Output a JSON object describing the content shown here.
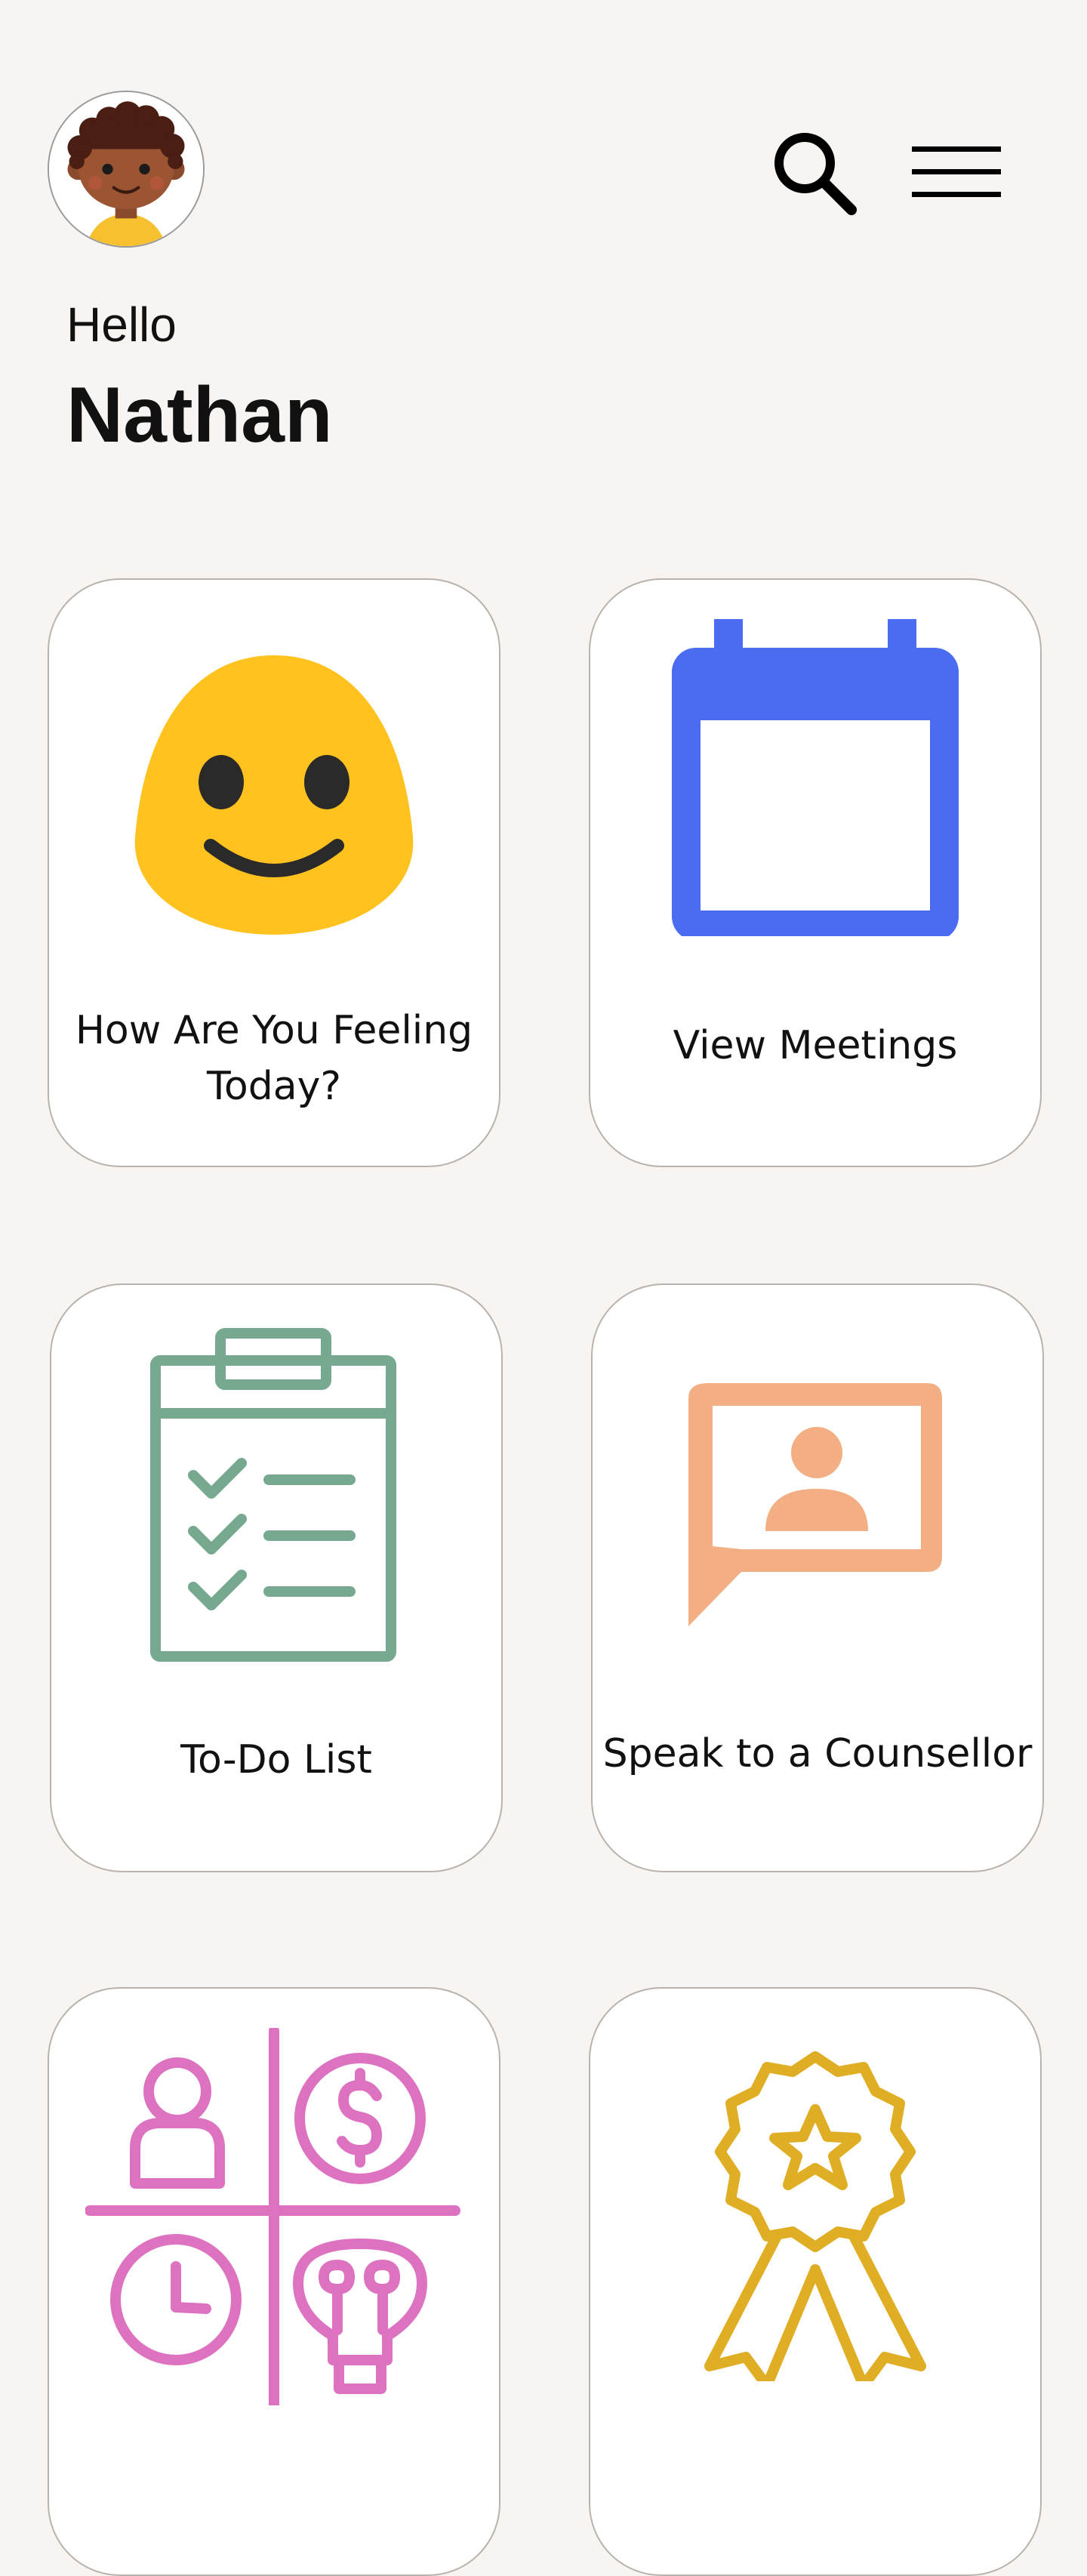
{
  "header": {
    "greeting": "Hello",
    "user_name": "Nathan"
  },
  "icons": {
    "avatar": "child-avatar",
    "search": "search-icon",
    "menu": "hamburger-menu-icon"
  },
  "cards": [
    {
      "label": "How Are You Feeling Today?",
      "icon": "smiley-face-icon",
      "color": "#FFC21F"
    },
    {
      "label": "View Meetings",
      "icon": "calendar-icon",
      "color": "#4A6CF0"
    },
    {
      "label": "To-Do List",
      "icon": "checklist-clipboard-icon",
      "color": "#76A98F"
    },
    {
      "label": "Speak to a Counsellor",
      "icon": "chat-person-icon",
      "color": "#F3AF83"
    },
    {
      "label": "",
      "icon": "quadrants-icon",
      "color": "#DD73C0"
    },
    {
      "label": "",
      "icon": "award-ribbon-icon",
      "color": "#E0AE24"
    }
  ]
}
